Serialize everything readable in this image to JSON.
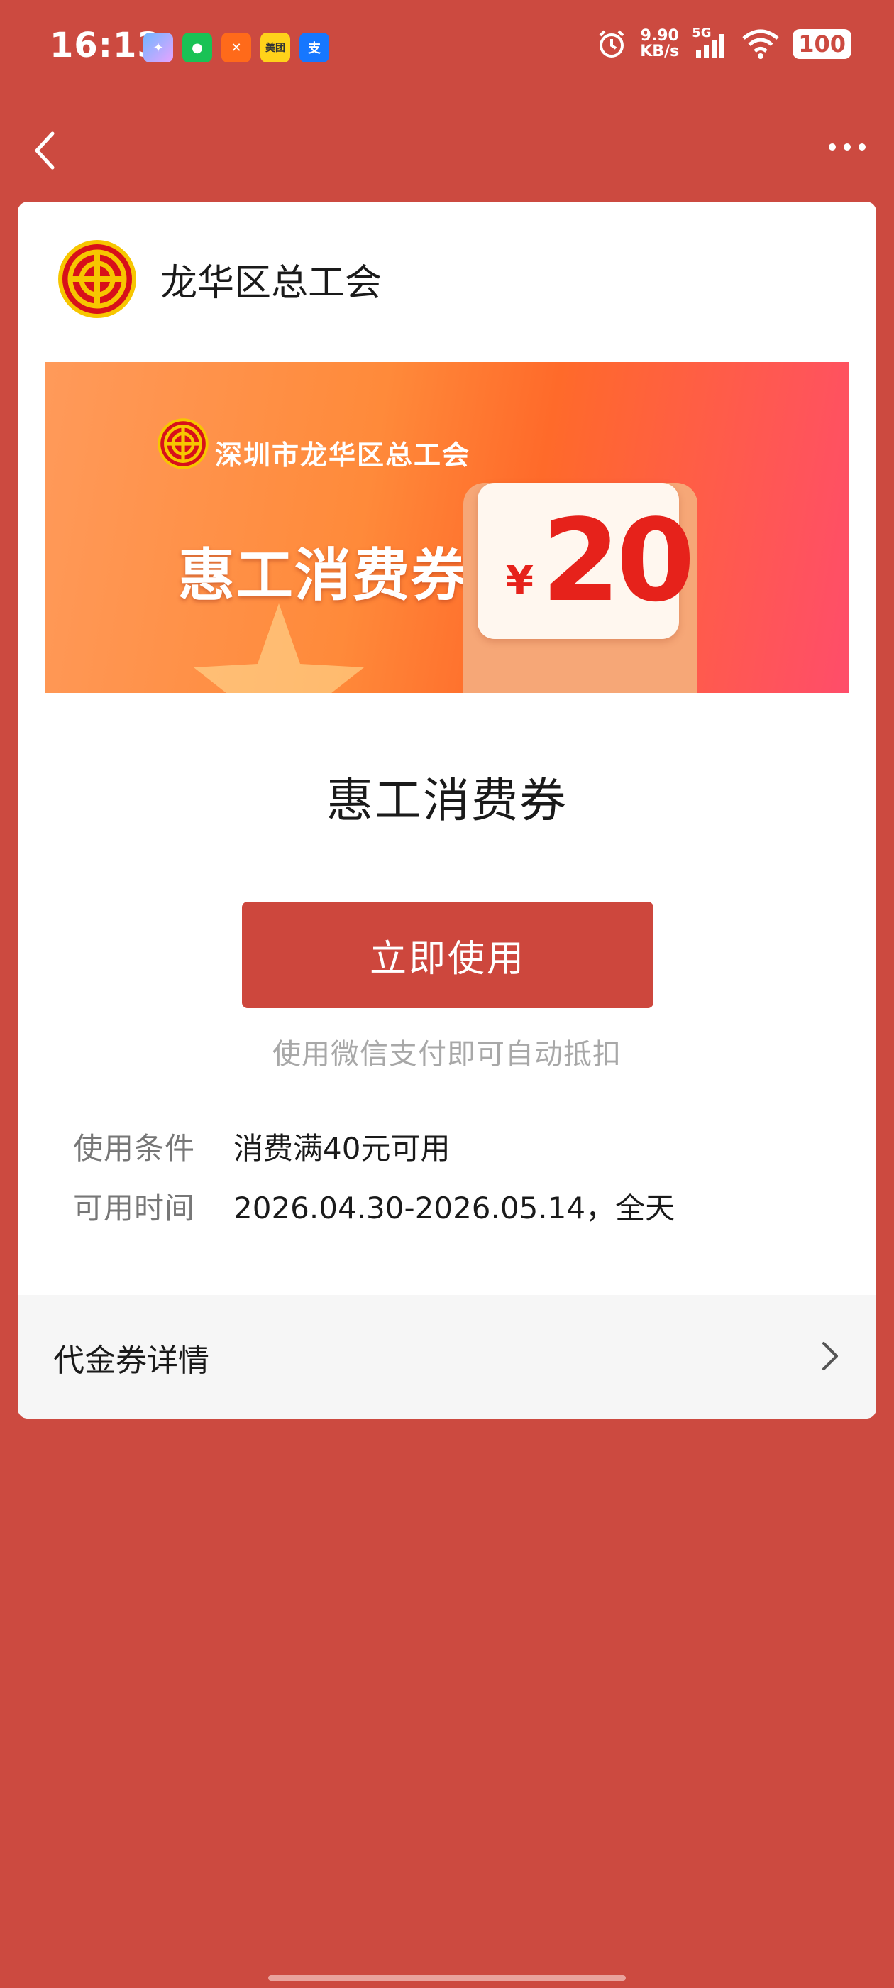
{
  "status_bar": {
    "time": "16:13",
    "app_icons": [
      "app-icon",
      "wechat-icon",
      "app-icon",
      "meituan-icon",
      "alipay-icon"
    ],
    "meituan_label": "美团",
    "alipay_label": "支",
    "net_speed_value": "9.90",
    "net_speed_unit": "KB/s",
    "signal": "5G",
    "battery": "100"
  },
  "nav": {
    "back_icon": "chevron-left-icon",
    "more_icon": "more-horizontal-icon"
  },
  "org": {
    "name": "龙华区总工会",
    "logo": "trade-union-logo"
  },
  "banner": {
    "org_name": "深圳市龙华区总工会",
    "title": "惠工消费券",
    "currency": "¥",
    "amount": "20"
  },
  "coupon": {
    "name": "惠工消费券",
    "use_button": "立即使用",
    "hint": "使用微信支付即可自动抵扣",
    "condition_label": "使用条件",
    "condition_value": "消费满40元可用",
    "time_label": "可用时间",
    "time_value": "2026.04.30-2026.05.14，全天"
  },
  "details": {
    "label": "代金券详情"
  },
  "colors": {
    "background": "#cc4a40",
    "button": "#cd473d",
    "amount_red": "#e6221b"
  }
}
